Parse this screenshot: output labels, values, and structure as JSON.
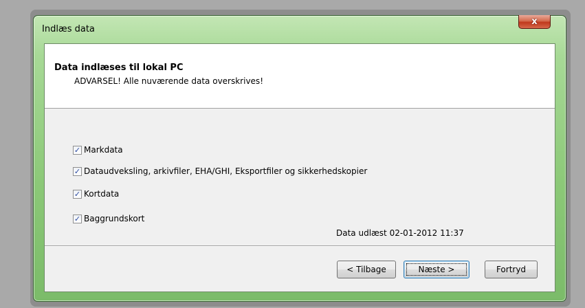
{
  "window": {
    "title": "Indlæs data",
    "close_label": "x"
  },
  "header": {
    "title": "Data indlæses til lokal PC",
    "subtitle": "ADVARSEL! Alle nuværende data overskrives!"
  },
  "options": [
    {
      "label": "Markdata",
      "checked": true
    },
    {
      "label": "Dataudveksling, arkivfiler, EHA/GHI, Eksportfiler og sikkerhedskopier",
      "checked": true
    },
    {
      "label": "Kortdata",
      "checked": true
    },
    {
      "label": "Baggrundskort",
      "checked": true
    }
  ],
  "read_info": "Data udlæst 02-01-2012 11:37",
  "buttons": {
    "back": "< Tilbage",
    "next": "Næste >",
    "cancel": "Fortryd"
  },
  "colors": {
    "window_frame": "#8bc877",
    "close_button": "#c0381c",
    "check_mark": "#2d4ba0"
  }
}
